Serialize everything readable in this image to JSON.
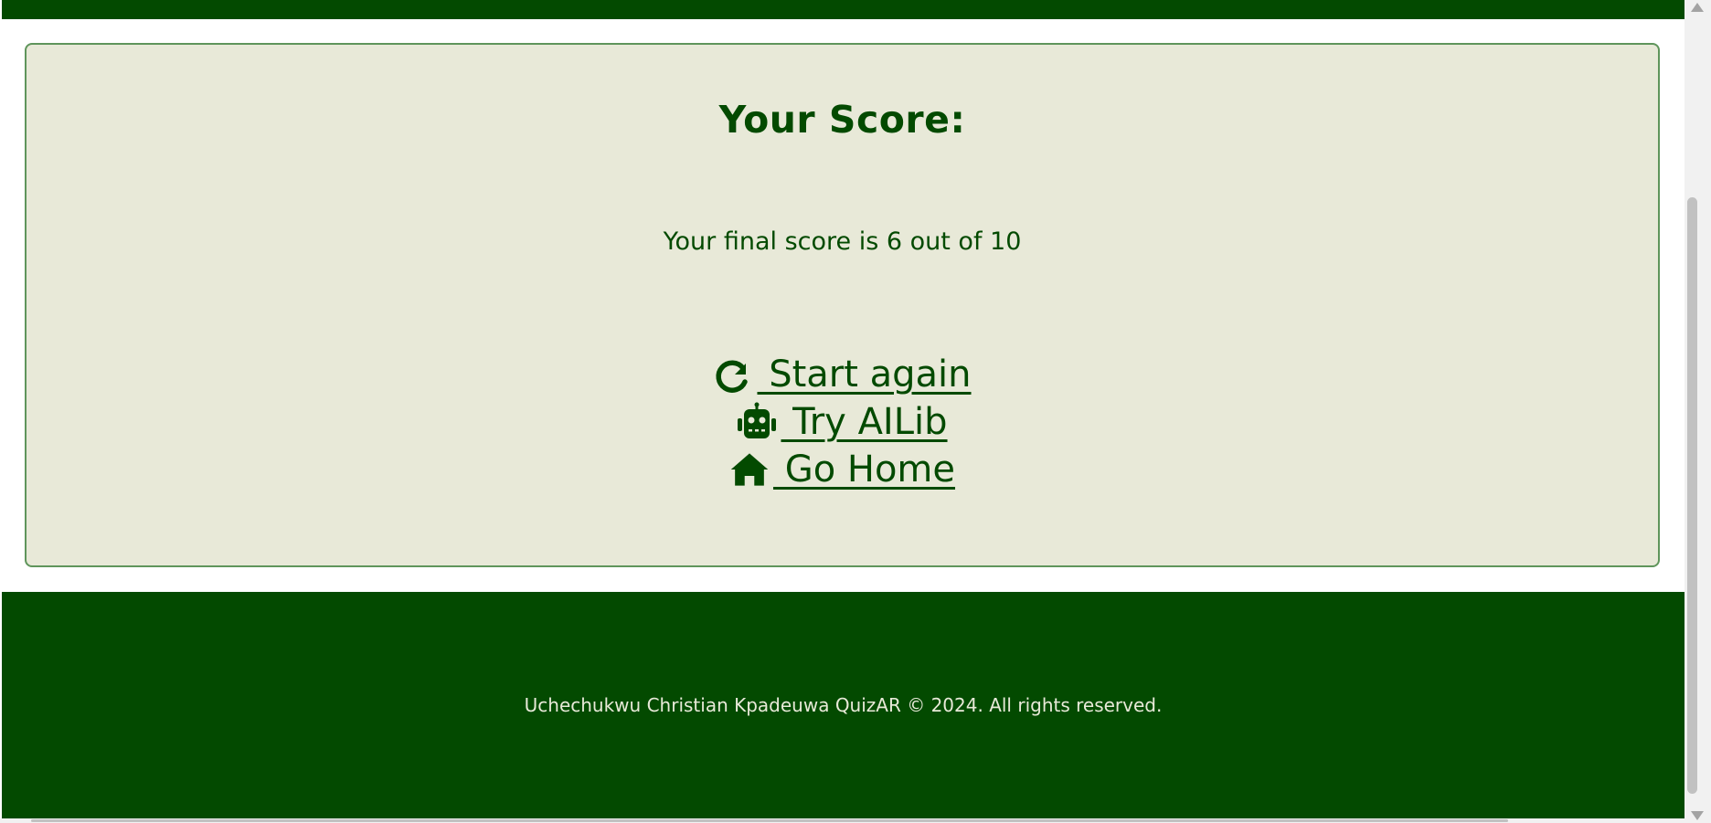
{
  "score_card": {
    "title": "Your Score:",
    "result_text": "Your final score is 6 out of 10"
  },
  "actions": [
    {
      "label": " Start again",
      "icon": "redo-icon"
    },
    {
      "label": " Try AILib",
      "icon": "robot-icon"
    },
    {
      "label": " Go Home",
      "icon": "home-icon"
    }
  ],
  "footer": {
    "text": "Uchechukwu Christian Kpadeuwa QuizAR © 2024. All rights reserved."
  },
  "colors": {
    "primary": "#034a00",
    "card_background": "#e8e9d8",
    "card_border": "#5f955b",
    "footer_text": "#e8e9d8"
  }
}
